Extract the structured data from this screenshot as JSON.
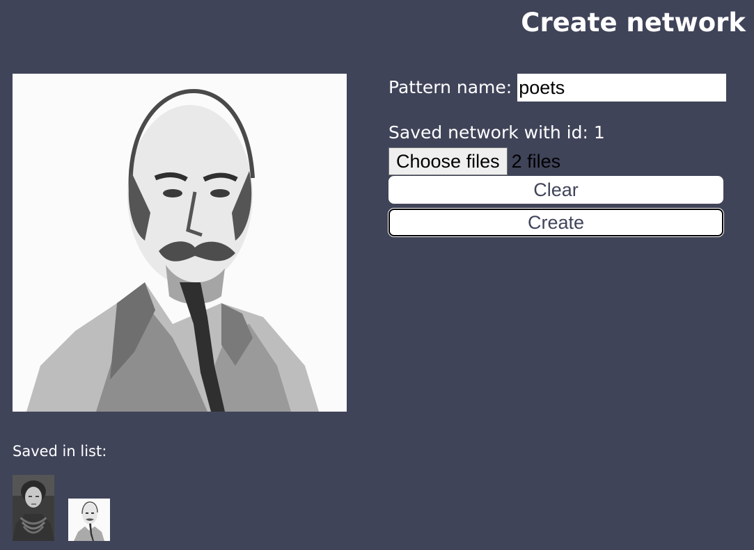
{
  "header": {
    "title": "Create network"
  },
  "form": {
    "pattern_label": "Pattern name:",
    "pattern_value": "poets",
    "status": "Saved network with id: 1",
    "choose_files_label": "Choose files",
    "file_count": "2 files",
    "clear_label": "Clear",
    "create_label": "Create"
  },
  "saved": {
    "label": "Saved in list:",
    "items": [
      {
        "icon": "portrait-woman-thumbnail"
      },
      {
        "icon": "portrait-man-thumbnail"
      }
    ]
  },
  "colors": {
    "background": "#404459",
    "text": "#ffffff",
    "button_background": "#ffffff",
    "button_text": "#404459"
  }
}
